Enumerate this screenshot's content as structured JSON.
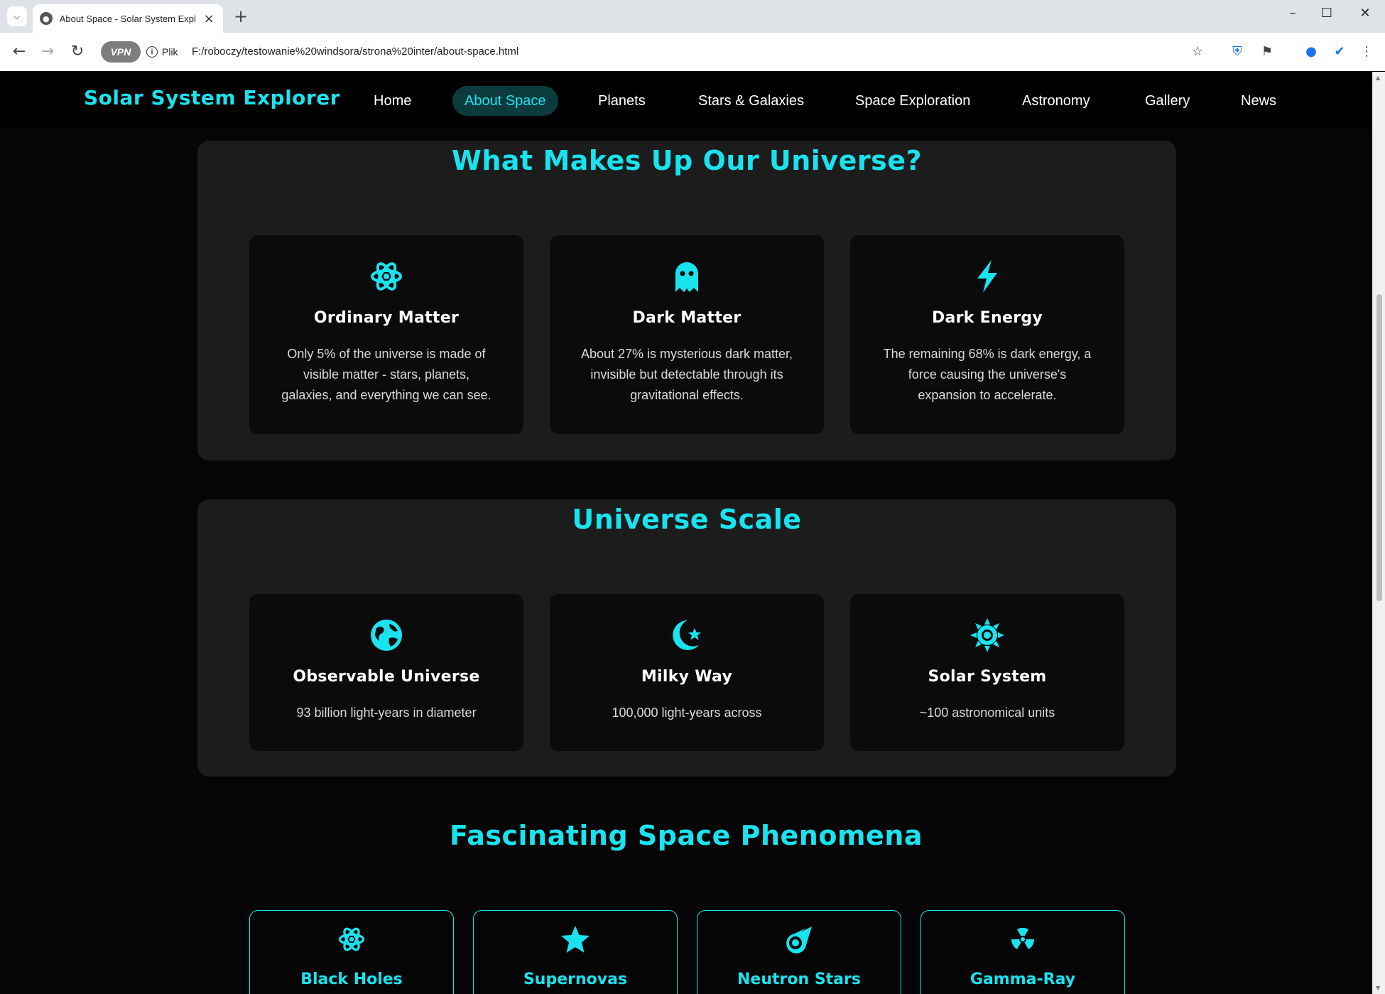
{
  "browser": {
    "tab_title": "About Space - Solar System Explor",
    "url_badge": "Plik",
    "vpn_label": "VPN",
    "url": "F:/roboczy/testowanie%20windsora/strona%20inter/about-space.html"
  },
  "site": {
    "logo": "Solar System Explorer",
    "nav": [
      {
        "label": "Home"
      },
      {
        "label": "About Space"
      },
      {
        "label": "Planets"
      },
      {
        "label": "Stars & Galaxies"
      },
      {
        "label": "Space Exploration"
      },
      {
        "label": "Astronomy"
      },
      {
        "label": "Gallery"
      },
      {
        "label": "News"
      }
    ],
    "active_nav": "About Space"
  },
  "universe": {
    "title": "What Makes Up Our Universe?",
    "cards": [
      {
        "icon": "atom-icon",
        "title": "Ordinary Matter",
        "lines": [
          "Only 5% of the universe is made of",
          "visible matter - stars, planets,",
          "galaxies, and everything we can see."
        ]
      },
      {
        "icon": "ghost-icon",
        "title": "Dark Matter",
        "lines": [
          "About 27% is mysterious dark matter,",
          "invisible but detectable through its",
          "gravitational effects."
        ]
      },
      {
        "icon": "bolt-icon",
        "title": "Dark Energy",
        "lines": [
          "The remaining 68% is dark energy, a",
          "force causing the universe's",
          "expansion to accelerate."
        ]
      }
    ]
  },
  "scale": {
    "title": "Universe Scale",
    "cards": [
      {
        "icon": "globe-icon",
        "title": "Observable Universe",
        "text": "93 billion light-years in diameter"
      },
      {
        "icon": "moon-star-icon",
        "title": "Milky Way",
        "text": "100,000 light-years across"
      },
      {
        "icon": "sun-icon",
        "title": "Solar System",
        "text": "~100 astronomical units"
      }
    ]
  },
  "phenomena": {
    "title": "Fascinating Space Phenomena",
    "cards": [
      {
        "icon": "atom-icon",
        "title": "Black Holes"
      },
      {
        "icon": "star-icon",
        "title": "Supernovas"
      },
      {
        "icon": "meteor-icon",
        "title": "Neutron Stars"
      },
      {
        "icon": "radiation-icon",
        "title": "Gamma-Ray"
      }
    ]
  },
  "colors": {
    "accent": "#19e3ef",
    "panel": "#1c1c1c",
    "card": "#0b0b0b",
    "background": "#050505"
  }
}
